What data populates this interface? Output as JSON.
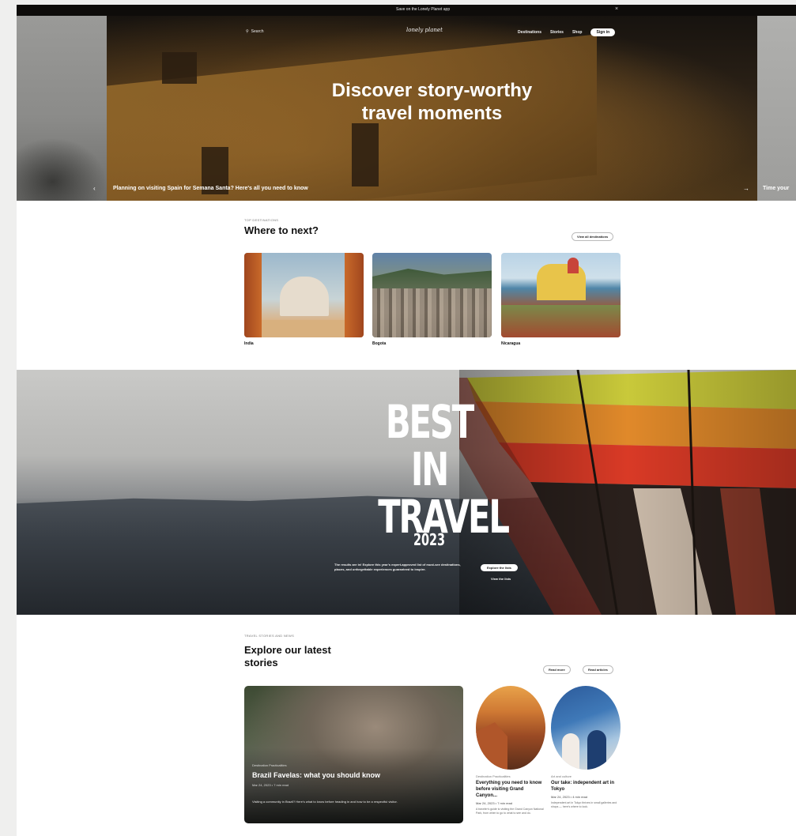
{
  "topbar": {
    "text": "Save on the Lonely Planet app",
    "close_icon": "close-icon"
  },
  "nav": {
    "search_label": "Search",
    "logo": "lonely planet",
    "links": [
      "Destinations",
      "Stories",
      "Shop"
    ],
    "signin_label": "Sign in"
  },
  "hero": {
    "title_line1": "Discover story-worthy",
    "title_line2": "travel moments",
    "caption": "Planning on visiting Spain for Semana Santa? Here's all you need to know",
    "right_caption": "Time your"
  },
  "where": {
    "eyebrow": "TOP DESTINATIONS",
    "title": "Where to next?",
    "view_all_label": "View all destinations",
    "destinations": [
      {
        "label": "India"
      },
      {
        "label": "Bogota"
      },
      {
        "label": "Nicaragua"
      }
    ]
  },
  "best_in_travel": {
    "title_line1": "BEST IN",
    "title_line2": "TRAVEL",
    "year": "2023",
    "description": "The results are in! Explore this year's expert-approved list of must-see destinations, places, and unforgettable experiences guaranteed to inspire.",
    "cta_label": "Explore the lists",
    "sub_label": "View the lists"
  },
  "stories": {
    "eyebrow": "TRAVEL STORIES AND NEWS",
    "title_line1": "Explore our latest",
    "title_line2": "stories",
    "btn_all": "Read more",
    "btn_guides": "Read articles",
    "feature": {
      "eyebrow": "Destination Practicalities",
      "title": "Brazil Favelas: what you should know",
      "date": "Mar 24, 2023 • 7 min read",
      "description": "Visiting a community in Brazil? Here's what to know before heading in and how to be a respectful visitor."
    },
    "cards": [
      {
        "eyebrow": "Destination Practicalities",
        "title": "Everything you need to know before visiting Grand Canyon...",
        "date": "Mar 24, 2023 • 7 min read",
        "description": "A traveler's guide to visiting the Grand Canyon National Park, from when to go to what to see and do."
      },
      {
        "eyebrow": "Art and culture",
        "title": "Our take: independent art in Tokyo",
        "date": "Mar 24, 2023 • 4 min read",
        "description": "Independent art in Tokyo thrives in small galleries and shops — here's where to look."
      }
    ]
  }
}
